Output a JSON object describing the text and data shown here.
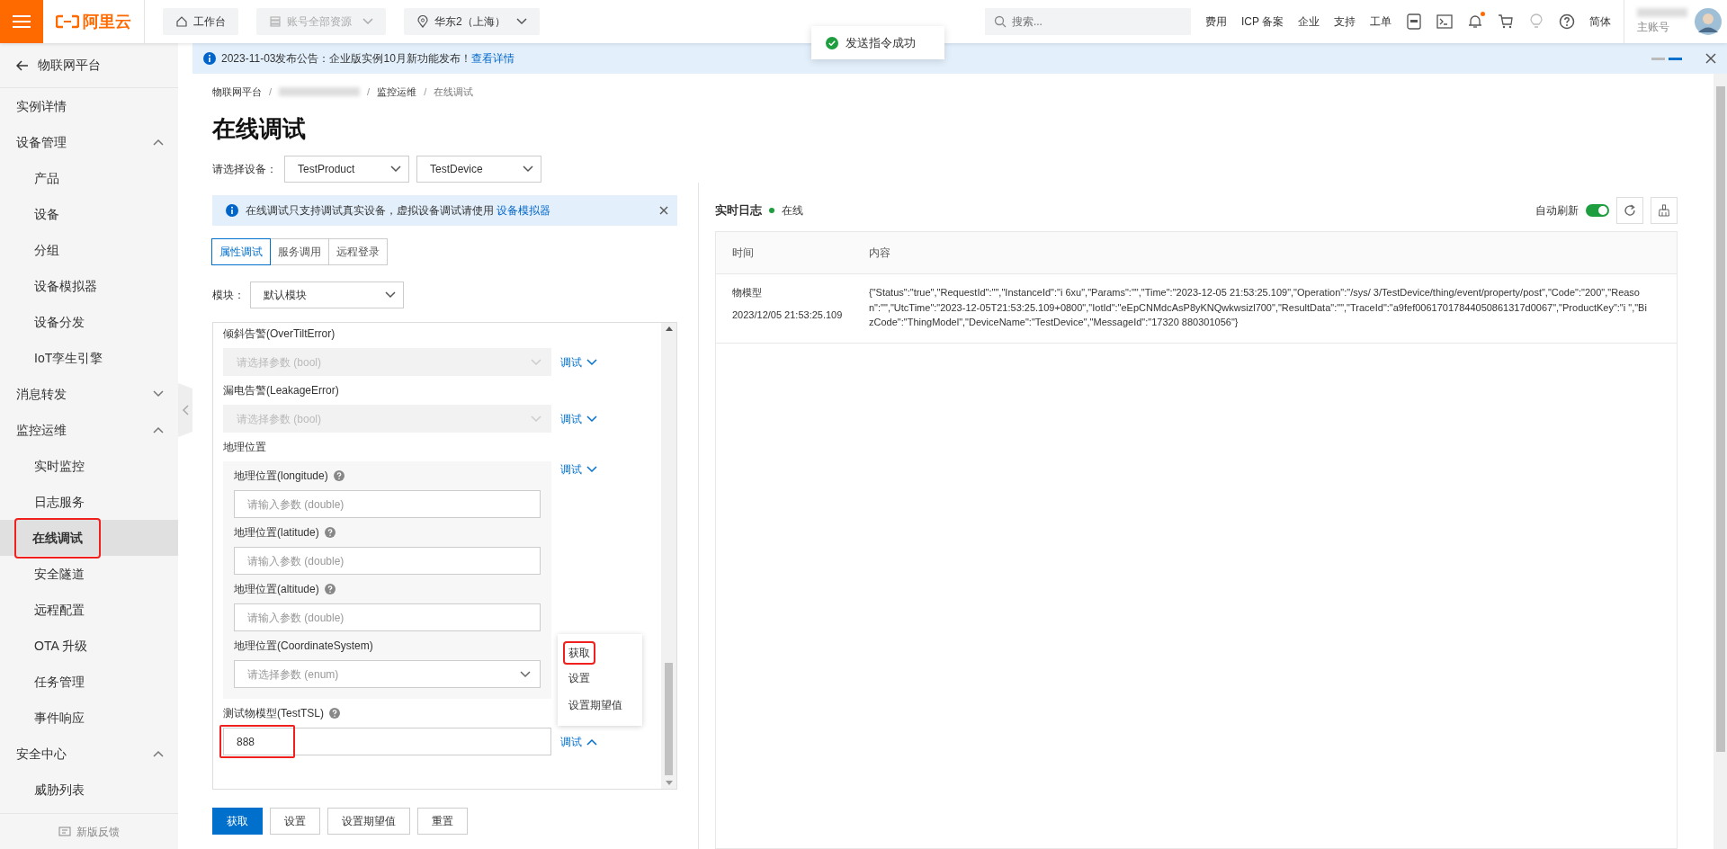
{
  "topbar": {
    "logo": "阿里云",
    "nav": [
      {
        "kind": "home",
        "label": "工作台",
        "disabled": false
      },
      {
        "kind": "resources",
        "label": "账号全部资源",
        "disabled": true
      },
      {
        "kind": "region",
        "label": "华东2（上海）",
        "disabled": false
      }
    ],
    "search": {
      "placeholder": "搜索..."
    },
    "links": [
      "费用",
      "ICP 备案",
      "企业",
      "支持",
      "工单"
    ],
    "unread": true,
    "language": "简体",
    "account": {
      "role": "主账号"
    }
  },
  "toast": {
    "text": "发送指令成功"
  },
  "announcement": {
    "text": "2023-11-03发布公告：企业版实例10月新功能发布！",
    "link": "查看详情"
  },
  "sidebar": {
    "back": "物联网平台",
    "items": [
      {
        "label": "实例详情",
        "selected": false
      },
      {
        "label": "设备管理",
        "selected": false,
        "expanded": true,
        "children": [
          {
            "label": "产品",
            "selected": false
          },
          {
            "label": "设备",
            "selected": false
          },
          {
            "label": "分组",
            "selected": false
          },
          {
            "label": "设备模拟器",
            "selected": false
          },
          {
            "label": "设备分发",
            "selected": false
          },
          {
            "label": "IoT孪生引擎",
            "selected": false
          }
        ]
      },
      {
        "label": "消息转发",
        "selected": false,
        "expanded": false
      },
      {
        "label": "监控运维",
        "selected": false,
        "expanded": true,
        "children": [
          {
            "label": "实时监控",
            "selected": false
          },
          {
            "label": "日志服务",
            "selected": false
          },
          {
            "label": "在线调试",
            "selected": true,
            "annotated": true
          },
          {
            "label": "安全隧道",
            "selected": false
          },
          {
            "label": "远程配置",
            "selected": false
          },
          {
            "label": "OTA 升级",
            "selected": false
          },
          {
            "label": "任务管理",
            "selected": false
          },
          {
            "label": "事件响应",
            "selected": false
          }
        ]
      },
      {
        "label": "安全中心",
        "selected": false,
        "expanded": true,
        "children": [
          {
            "label": "威胁列表",
            "selected": false
          }
        ]
      }
    ],
    "footer": "新版反馈"
  },
  "breadcrumb": {
    "separator": "/",
    "items": [
      {
        "kind": "link",
        "label": "物联网平台"
      },
      {
        "kind": "redacted"
      },
      {
        "kind": "link",
        "label": "监控运维"
      },
      {
        "kind": "current",
        "label": "在线调试"
      }
    ]
  },
  "page_title": "在线调试",
  "device_select": {
    "label": "请选择设备：",
    "product": "TestProduct",
    "device": "TestDevice"
  },
  "alert": {
    "text": "在线调试只支持调试真实设备，虚拟设备调试请使用",
    "link": "设备模拟器"
  },
  "tabs": [
    {
      "label": "属性调试",
      "selected": true
    },
    {
      "label": "服务调用",
      "selected": false
    },
    {
      "label": "远程登录",
      "selected": false
    }
  ],
  "module": {
    "label": "模块：",
    "value": "默认模块"
  },
  "properties": [
    {
      "kind": "select",
      "label": "倾斜告警(OverTiltError)",
      "placeholder": "请选择参数 (bool)",
      "disabled": true,
      "debug": "调试",
      "expanded": false
    },
    {
      "kind": "select",
      "label": "漏电告警(LeakageError)",
      "placeholder": "请选择参数 (bool)",
      "disabled": true,
      "debug": "调试",
      "expanded": false
    },
    {
      "kind": "struct",
      "label": "地理位置",
      "debug": "调试",
      "expanded": false,
      "fields": [
        {
          "kind": "input",
          "label": "地理位置(longitude)",
          "help": true,
          "placeholder": "请输入参数 (double)"
        },
        {
          "kind": "input",
          "label": "地理位置(latitude)",
          "help": true,
          "placeholder": "请输入参数 (double)"
        },
        {
          "kind": "input",
          "label": "地理位置(altitude)",
          "help": true,
          "placeholder": "请输入参数 (double)"
        },
        {
          "kind": "select",
          "label": "地理位置(CoordinateSystem)",
          "placeholder": "请选择参数 (enum)",
          "disabled": false
        }
      ]
    },
    {
      "kind": "input",
      "label": "测试物模型(TestTSL)",
      "help": true,
      "value": "888",
      "annotated": true,
      "debug": "调试",
      "expanded": true,
      "menu": [
        {
          "label": "获取",
          "annotated": true
        },
        {
          "label": "设置",
          "annotated": false
        },
        {
          "label": "设置期望值",
          "annotated": false
        }
      ]
    }
  ],
  "actions": [
    {
      "label": "获取",
      "primary": true
    },
    {
      "label": "设置",
      "primary": false
    },
    {
      "label": "设置期望值",
      "primary": false
    },
    {
      "label": "重置",
      "primary": false
    }
  ],
  "log": {
    "title": "实时日志",
    "status": {
      "label": "在线",
      "color": "#1e9e3e"
    },
    "auto_refresh": {
      "label": "自动刷新",
      "on": true
    },
    "columns": [
      "时间",
      "内容"
    ],
    "rows": [
      {
        "type": "物模型",
        "time": "2023/12/05 21:53:25.109",
        "content": "{\"Status\":\"true\",\"RequestId\":\"\",\"InstanceId\":\"i 6xu\",\"Params\":\"\",\"Time\":\"2023-12-05 21:53:25.109\",\"Operation\":\"/sys/ 3/TestDevice/thing/event/property/post\",\"Code\":\"200\",\"Reason\":\"\",\"UtcTime\":\"2023-12-05T21:53:25.109+0800\",\"IotId\":\"eEpCNMdcAsP8yKNQwkwsizl700\",\"ResultData\":\"\",\"TraceId\":\"a9fef00617017844050861317d0067\",\"ProductKey\":\"i \",\"BizCode\":\"ThingModel\",\"DeviceName\":\"TestDevice\",\"MessageId\":\"17320 880301056\"}"
      }
    ]
  }
}
